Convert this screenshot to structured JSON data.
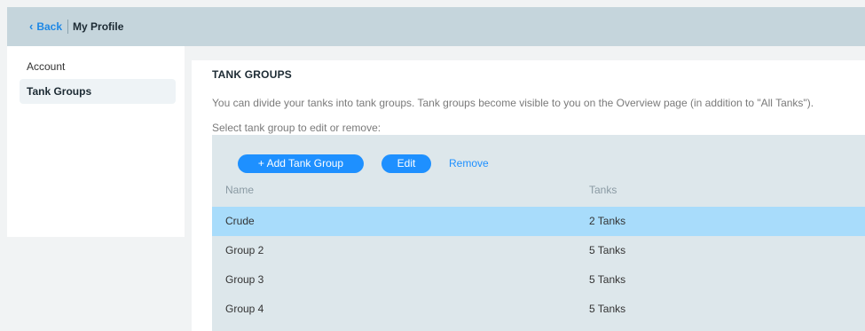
{
  "header": {
    "back_label": "Back",
    "title": "My Profile"
  },
  "sidebar": {
    "items": [
      {
        "label": "Account"
      },
      {
        "label": "Tank Groups"
      }
    ]
  },
  "main": {
    "section_title": "TANK GROUPS",
    "description": "You can divide your tanks into tank groups. Tank groups become visible to you on the Overview page (in addition to \"All Tanks\").",
    "instruction": "Select tank group to edit or remove:",
    "toolbar": {
      "add_label": "+ Add Tank Group",
      "edit_label": "Edit",
      "remove_label": "Remove"
    },
    "table": {
      "columns": [
        "Name",
        "Tanks"
      ],
      "rows": [
        {
          "name": "Crude",
          "tanks": "2 Tanks",
          "selected": true
        },
        {
          "name": "Group 2",
          "tanks": "5 Tanks",
          "selected": false
        },
        {
          "name": "Group 3",
          "tanks": "5 Tanks",
          "selected": false
        },
        {
          "name": "Group 4",
          "tanks": "5 Tanks",
          "selected": false
        }
      ]
    }
  },
  "colors": {
    "accent": "#1e90ff",
    "selected_row": "#a8dcfb",
    "header_bar": "#c5d5dc",
    "panel": "#dde7eb"
  }
}
